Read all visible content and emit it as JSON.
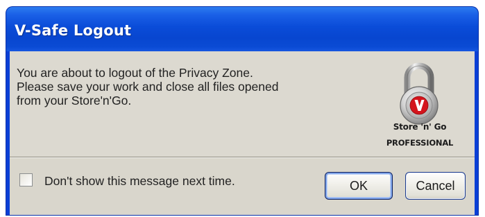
{
  "window": {
    "title": "V-Safe Logout"
  },
  "message": {
    "lines": [
      "You are about to logout of the Privacy Zone.",
      "Please save your work and close all files opened",
      "from your Store'n'Go."
    ]
  },
  "branding": {
    "logo_icon": "padlock-icon",
    "logo_letter": "V",
    "line1": "Store 'n' Go",
    "line2": "PROFESSIONAL",
    "colors": {
      "title_bar": "#0a4cd8",
      "logo_red": "#d4141c"
    }
  },
  "options": {
    "dont_show_label": "Don't show this message next time.",
    "dont_show_checked": false
  },
  "buttons": {
    "ok_label": "OK",
    "cancel_label": "Cancel"
  }
}
